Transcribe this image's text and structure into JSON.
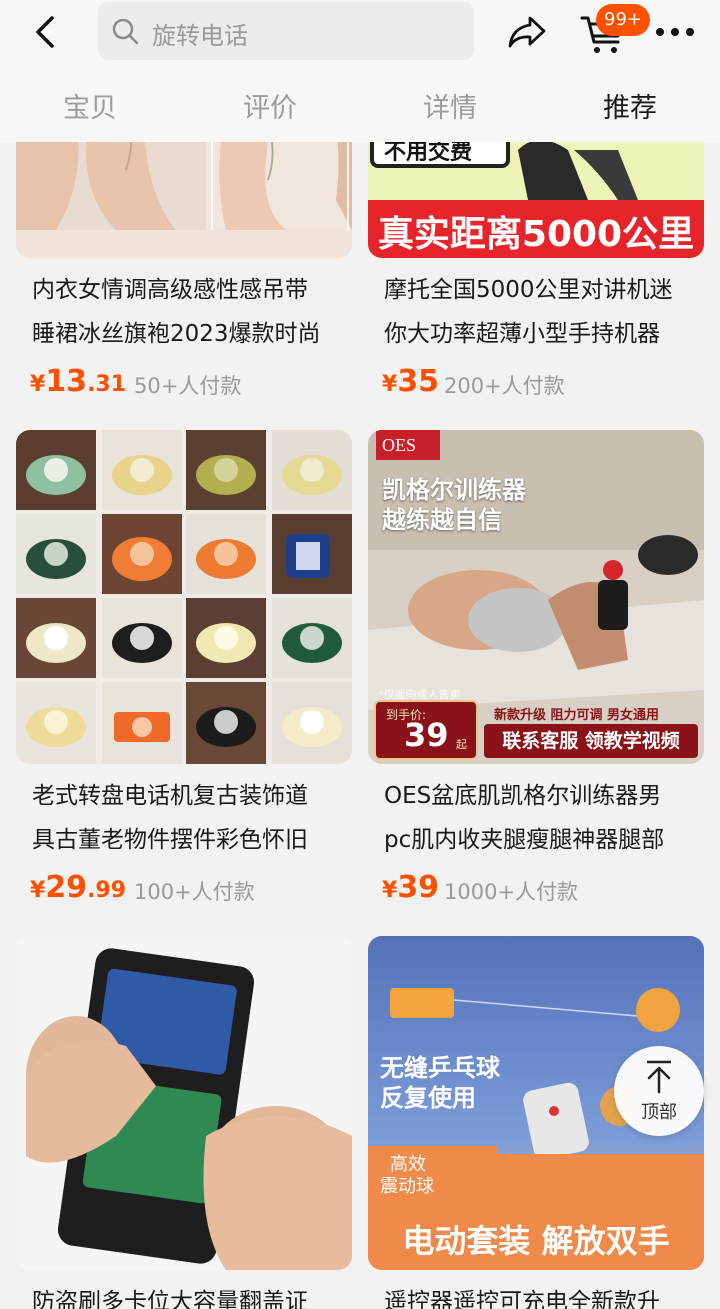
{
  "search": {
    "placeholder": "旋转电话"
  },
  "cart": {
    "badge": "99+"
  },
  "tabs": [
    {
      "label": "宝贝"
    },
    {
      "label": "评价"
    },
    {
      "label": "详情"
    },
    {
      "label": "推荐"
    }
  ],
  "products": [
    {
      "title_lines": [
        "内衣女情调高级感性感吊带",
        "睡裙冰丝旗袍2023爆款时尚"
      ],
      "price_int": "13",
      "price_dec": ".31",
      "sold": "50+人付款",
      "image_text": []
    },
    {
      "title_lines": [
        "摩托全国5000公里对讲机迷",
        "你大功率超薄小型手持机器"
      ],
      "price_int": "35",
      "price_dec": "",
      "sold": "200+人付款",
      "image_text": [
        "不用交费",
        "真实距离5000公里"
      ]
    },
    {
      "title_lines": [
        "老式转盘电话机复古装饰道",
        "具古董老物件摆件彩色怀旧"
      ],
      "price_int": "29",
      "price_dec": ".99",
      "sold": "100+人付款",
      "image_text": []
    },
    {
      "title_lines": [
        "OES盆底肌凯格尔训练器男",
        "pc肌内收夹腿瘦腿神器腿部"
      ],
      "price_int": "39",
      "price_dec": "",
      "sold": "1000+人付款",
      "image_text": [
        "OES",
        "凯格尔训练器",
        "越练越自信",
        "*仅面向成人售卖",
        "到手价:",
        "39",
        "起",
        "新款升级 阻力可调 男女通用",
        "联系客服 领教学视频"
      ]
    },
    {
      "title_lines": [
        "防盗刷多卡位大容量翻盖证"
      ],
      "price_int": "",
      "price_dec": "",
      "sold": "",
      "image_text": []
    },
    {
      "title_lines": [
        "遥控器遥控可充电全新款升"
      ],
      "price_int": "",
      "price_dec": "",
      "sold": "",
      "image_text": [
        "无缝乒乓球",
        "反复使用",
        "高效",
        "震动球",
        "电动套装 解放双手"
      ]
    }
  ],
  "currency": "¥",
  "back_to_top": {
    "label": "顶部"
  },
  "colors": {
    "accent": "#ff5000",
    "muted": "#9a9a9a"
  }
}
